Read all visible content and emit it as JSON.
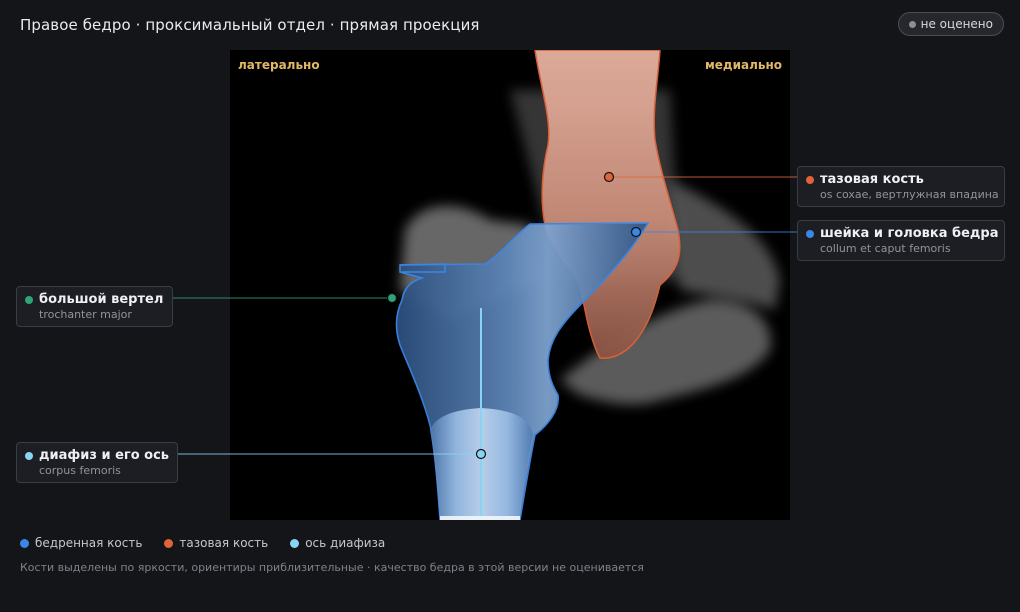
{
  "header": {
    "title": "Правое бедро · проксимальный отдел · прямая проекция",
    "status_label": "не оценено"
  },
  "image": {
    "orientation_left": "латерально",
    "orientation_right": "медиально"
  },
  "callouts": {
    "pelvis": {
      "title": "тазовая кость",
      "subtitle": "os coxae, вертлужная впадина",
      "color": "#e0643a"
    },
    "neck": {
      "title": "шейка и головка бедра",
      "subtitle": "collum et caput femoris",
      "color": "#3b86e6"
    },
    "trochanter": {
      "title": "большой вертел",
      "subtitle": "trochanter major",
      "color": "#2fa37a"
    },
    "shaft": {
      "title": "диафиз и его ось",
      "subtitle": "corpus femoris",
      "color": "#8ad3f5"
    }
  },
  "legend": [
    {
      "label": "бедренная кость",
      "color": "#3b86e6"
    },
    {
      "label": "тазовая кость",
      "color": "#e0643a"
    },
    {
      "label": "ось диафиза",
      "color": "#8ad3f5"
    }
  ],
  "footnote": "Кости выделены по яркости, ориентиры приблизительные · качество бедра в этой версии не оценивается",
  "colors": {
    "femur_outline": "#3b86e6",
    "pelvis_outline": "#e0643a",
    "axis": "#8ad3f5",
    "orientation_text": "#e2b867"
  }
}
